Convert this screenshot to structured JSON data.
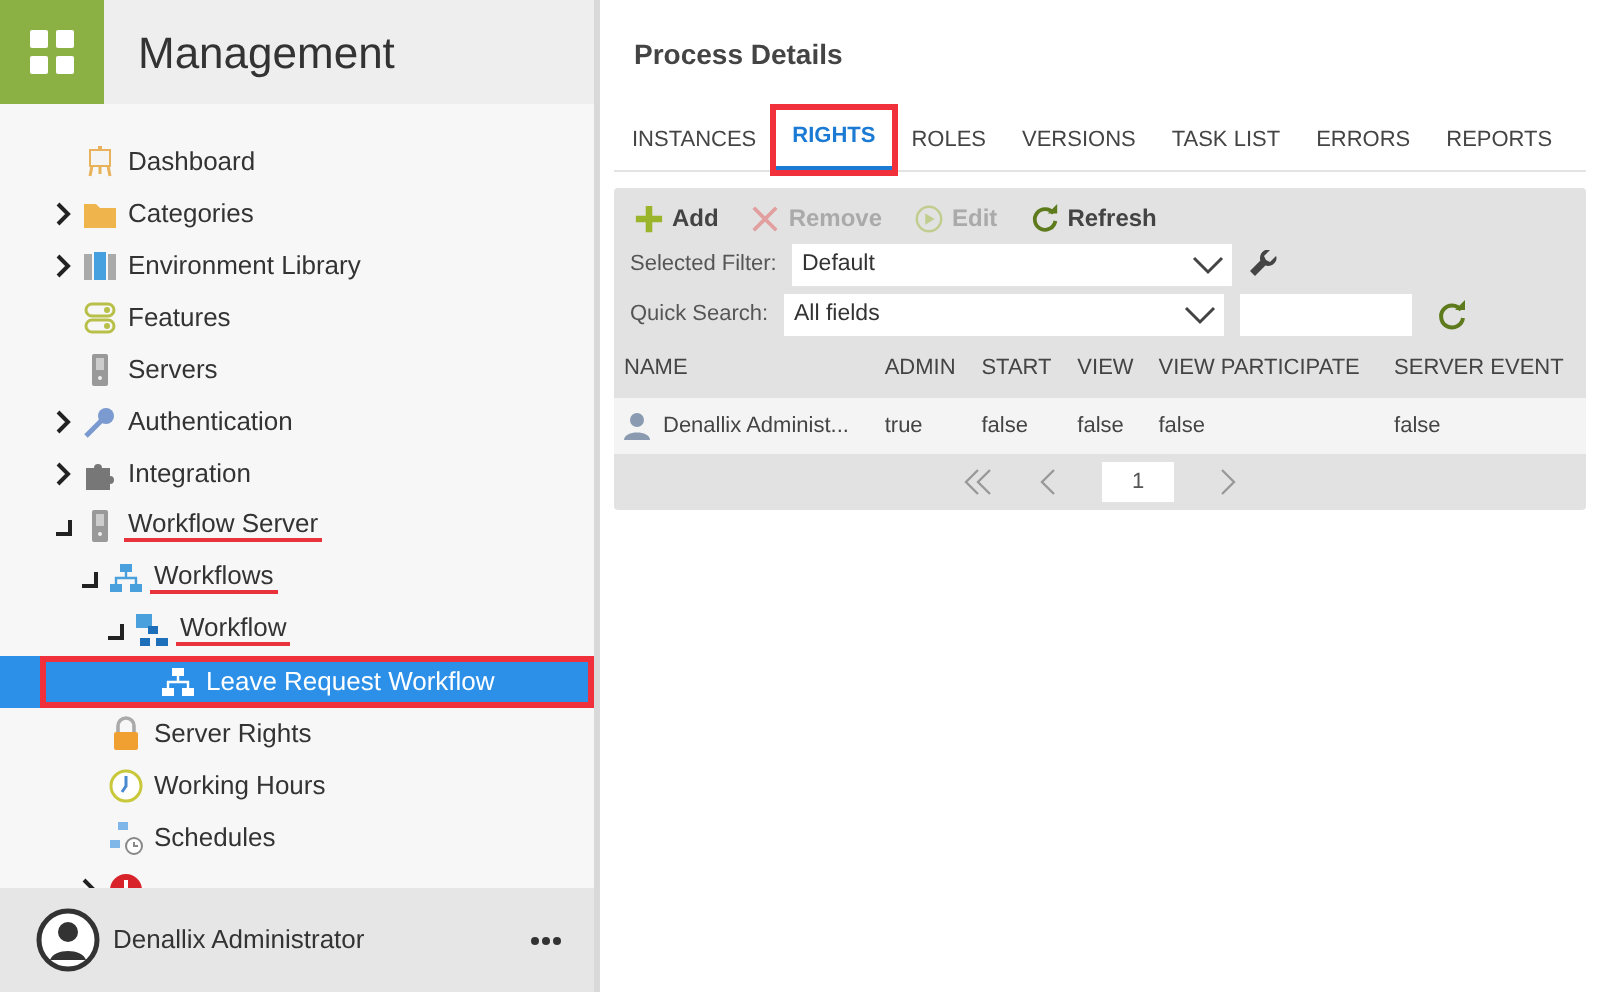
{
  "sidebar": {
    "title": "Management",
    "tree": [
      {
        "label": "Dashboard",
        "kind": "easel"
      },
      {
        "label": "Categories",
        "kind": "folder",
        "expanded": false
      },
      {
        "label": "Environment Library",
        "kind": "library",
        "expanded": false
      },
      {
        "label": "Features",
        "kind": "toggles"
      },
      {
        "label": "Servers",
        "kind": "server"
      },
      {
        "label": "Authentication",
        "kind": "key",
        "expanded": false
      },
      {
        "label": "Integration",
        "kind": "puzzle",
        "expanded": false
      },
      {
        "label": "Workflow Server",
        "kind": "server",
        "expanded": true,
        "annotated": true,
        "children": [
          {
            "label": "Workflows",
            "kind": "hierarchy",
            "expanded": true,
            "annotated": true,
            "children": [
              {
                "label": "Workflow",
                "kind": "hierarchy2",
                "expanded": true,
                "annotated": true,
                "children": [
                  {
                    "label": "Leave Request Workflow",
                    "kind": "hierarchy",
                    "selected": true,
                    "annotated": true
                  }
                ]
              }
            ]
          },
          {
            "label": "Server Rights",
            "kind": "lock",
            "selected": false
          },
          {
            "label": "Working Hours",
            "kind": "clock",
            "selected": false
          },
          {
            "label": "Schedules",
            "kind": "schedule",
            "selected": false
          },
          {
            "kind": "error",
            "expanded": false
          }
        ]
      }
    ],
    "user": {
      "name": "Denallix Administrator"
    }
  },
  "main": {
    "title": "Process Details",
    "tabs": [
      {
        "label": "INSTANCES",
        "selected": false,
        "annotated": false
      },
      {
        "label": "RIGHTS",
        "selected": true,
        "annotated": true
      },
      {
        "label": "ROLES",
        "selected": false,
        "annotated": false
      },
      {
        "label": "VERSIONS",
        "selected": false,
        "annotated": false
      },
      {
        "label": "TASK LIST",
        "selected": false,
        "annotated": false
      },
      {
        "label": "ERRORS",
        "selected": false,
        "annotated": false
      },
      {
        "label": "REPORTS",
        "selected": false,
        "annotated": false
      }
    ],
    "toolbar": [
      {
        "label": "Add",
        "kind": "add",
        "disabled": false
      },
      {
        "label": "Remove",
        "kind": "remove",
        "disabled": true
      },
      {
        "label": "Edit",
        "kind": "edit",
        "disabled": true
      },
      {
        "label": "Refresh",
        "kind": "refresh",
        "disabled": false
      }
    ],
    "filter": {
      "label": "Selected Filter:",
      "value": "Default"
    },
    "quick_search": {
      "label": "Quick Search:",
      "value": "All fields"
    },
    "table": {
      "columns": [
        "NAME",
        "ADMIN",
        "START",
        "VIEW",
        "VIEW PARTICIPATE",
        "SERVER EVENT"
      ],
      "rows": [
        [
          "Denallix Administ...",
          "true",
          "false",
          "false",
          "false",
          "false"
        ]
      ]
    },
    "pager": {
      "page": "1"
    }
  }
}
